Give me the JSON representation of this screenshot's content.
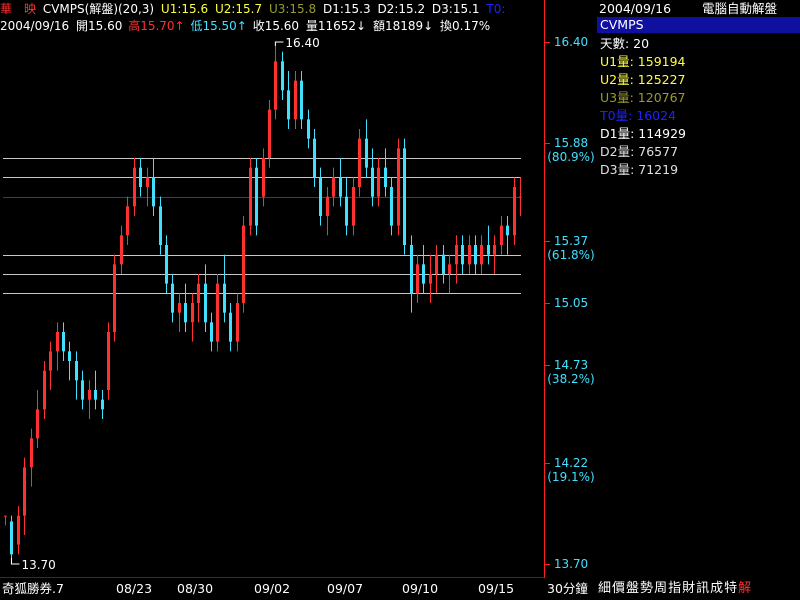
{
  "header": {
    "stock_name": "華　映",
    "indicator": "CVMPS(解盤)(20,3)",
    "u1": "U1:15.6",
    "u2": "U2:15.7",
    "u3": "U3:15.8",
    "d1": "D1:15.3",
    "d2": "D2:15.2",
    "d3": "D3:15.1",
    "t0": "T0:",
    "date": "2004/09/16",
    "open": "開15.60",
    "high": "高15.70↑",
    "low": "低15.50↑",
    "close": "收15.60",
    "volume": "量11652↓",
    "amount": "額18189↓",
    "turnover": "換0.17%"
  },
  "right_panel": {
    "date": "2004/09/16",
    "title": "電腦自動解盤",
    "indicator": "CVMPS",
    "days": "天數: 20",
    "u1": "U1量: 159194",
    "u2": "U2量: 125227",
    "u3": "U3量: 120767",
    "t0": "T0量: 16024",
    "d1": "D1量: 114929",
    "d2": "D2量: 76577",
    "d3": "D3量: 71219"
  },
  "bottom_bar": {
    "source": "奇狐勝券.7",
    "dates": [
      "08/23",
      "08/30",
      "09/02",
      "09/07",
      "09/10",
      "09/15"
    ],
    "period": "30分鐘",
    "menu": [
      "細",
      "價",
      "盤",
      "勢",
      "周",
      "指",
      "財",
      "訊",
      "成",
      "特",
      "解"
    ]
  },
  "colors": {
    "up": "#ff3030",
    "down": "#40e0ff",
    "axis": "#ff2020",
    "axis_text": "#40e0ff",
    "u1": "#ffff40",
    "u2": "#ffff40",
    "u3": "#9a9a30",
    "t0": "#2020ff",
    "hline": "#c8c8c8",
    "blue_line": "#2828ff",
    "highlight_bg": "#1010a0"
  },
  "chart_data": {
    "type": "candlestick",
    "ylim": [
      13.7,
      16.4
    ],
    "y_ticks": [
      {
        "value": 16.4,
        "label": "16.40",
        "pct": ""
      },
      {
        "value": 15.88,
        "label": "15.88",
        "pct": "(80.9%)"
      },
      {
        "value": 15.37,
        "label": "15.37",
        "pct": "(61.8%)"
      },
      {
        "value": 15.05,
        "label": "15.05",
        "pct": ""
      },
      {
        "value": 14.73,
        "label": "14.73",
        "pct": "(38.2%)"
      },
      {
        "value": 14.22,
        "label": "14.22",
        "pct": "(19.1%)"
      },
      {
        "value": 13.7,
        "label": "13.70",
        "pct": ""
      }
    ],
    "high_label": "16.40",
    "low_label": "13.70",
    "levels": [
      {
        "name": "U3",
        "value": 15.8
      },
      {
        "name": "U2",
        "value": 15.7
      },
      {
        "name": "U1",
        "value": 15.6
      },
      {
        "name": "D1",
        "value": 15.3
      },
      {
        "name": "D2",
        "value": 15.2
      },
      {
        "name": "D3",
        "value": 15.1
      }
    ],
    "candles": [
      [
        13.95,
        13.95,
        13.9,
        13.95
      ],
      [
        13.92,
        13.95,
        13.7,
        13.75
      ],
      [
        13.8,
        14.0,
        13.75,
        13.95
      ],
      [
        13.95,
        14.25,
        13.85,
        14.2
      ],
      [
        14.2,
        14.4,
        14.1,
        14.35
      ],
      [
        14.35,
        14.6,
        14.3,
        14.5
      ],
      [
        14.5,
        14.75,
        14.45,
        14.7
      ],
      [
        14.7,
        14.85,
        14.6,
        14.8
      ],
      [
        14.8,
        14.95,
        14.7,
        14.9
      ],
      [
        14.9,
        14.95,
        14.75,
        14.8
      ],
      [
        14.8,
        14.85,
        14.65,
        14.75
      ],
      [
        14.75,
        14.8,
        14.55,
        14.65
      ],
      [
        14.65,
        14.7,
        14.5,
        14.55
      ],
      [
        14.55,
        14.65,
        14.45,
        14.6
      ],
      [
        14.6,
        14.7,
        14.5,
        14.55
      ],
      [
        14.55,
        14.6,
        14.45,
        14.5
      ],
      [
        14.6,
        14.95,
        14.55,
        14.9
      ],
      [
        14.9,
        15.3,
        14.85,
        15.25
      ],
      [
        15.25,
        15.45,
        15.2,
        15.4
      ],
      [
        15.4,
        15.6,
        15.35,
        15.55
      ],
      [
        15.55,
        15.8,
        15.5,
        15.75
      ],
      [
        15.75,
        15.8,
        15.6,
        15.65
      ],
      [
        15.65,
        15.75,
        15.55,
        15.7
      ],
      [
        15.7,
        15.8,
        15.5,
        15.55
      ],
      [
        15.55,
        15.6,
        15.3,
        15.35
      ],
      [
        15.35,
        15.4,
        15.1,
        15.15
      ],
      [
        15.15,
        15.2,
        14.95,
        15.0
      ],
      [
        15.0,
        15.1,
        14.9,
        15.05
      ],
      [
        15.05,
        15.15,
        14.9,
        14.95
      ],
      [
        14.95,
        15.1,
        14.85,
        15.05
      ],
      [
        15.05,
        15.2,
        14.95,
        15.15
      ],
      [
        15.15,
        15.25,
        14.9,
        14.95
      ],
      [
        14.95,
        15.0,
        14.8,
        14.85
      ],
      [
        14.85,
        15.2,
        14.8,
        15.15
      ],
      [
        15.15,
        15.3,
        14.95,
        15.0
      ],
      [
        15.0,
        15.05,
        14.8,
        14.85
      ],
      [
        14.85,
        15.1,
        14.8,
        15.05
      ],
      [
        15.05,
        15.5,
        15.0,
        15.45
      ],
      [
        15.45,
        15.8,
        15.4,
        15.75
      ],
      [
        15.75,
        15.8,
        15.4,
        15.45
      ],
      [
        15.6,
        15.85,
        15.55,
        15.8
      ],
      [
        15.8,
        16.1,
        15.75,
        16.05
      ],
      [
        16.05,
        16.4,
        16.0,
        16.3
      ],
      [
        16.3,
        16.35,
        16.1,
        16.15
      ],
      [
        16.15,
        16.25,
        15.95,
        16.0
      ],
      [
        16.0,
        16.25,
        15.95,
        16.2
      ],
      [
        16.2,
        16.25,
        15.95,
        16.0
      ],
      [
        16.0,
        16.05,
        15.85,
        15.9
      ],
      [
        15.9,
        15.95,
        15.65,
        15.7
      ],
      [
        15.7,
        15.75,
        15.45,
        15.5
      ],
      [
        15.5,
        15.65,
        15.4,
        15.6
      ],
      [
        15.6,
        15.75,
        15.55,
        15.7
      ],
      [
        15.7,
        15.8,
        15.55,
        15.6
      ],
      [
        15.6,
        15.7,
        15.4,
        15.45
      ],
      [
        15.45,
        15.7,
        15.4,
        15.65
      ],
      [
        15.65,
        15.95,
        15.6,
        15.9
      ],
      [
        15.9,
        16.0,
        15.7,
        15.75
      ],
      [
        15.75,
        15.85,
        15.55,
        15.6
      ],
      [
        15.6,
        15.8,
        15.55,
        15.75
      ],
      [
        15.75,
        15.85,
        15.6,
        15.65
      ],
      [
        15.65,
        15.7,
        15.4,
        15.45
      ],
      [
        15.45,
        15.9,
        15.4,
        15.85
      ],
      [
        15.85,
        15.9,
        15.3,
        15.35
      ],
      [
        15.35,
        15.4,
        15.0,
        15.1
      ],
      [
        15.1,
        15.3,
        15.05,
        15.25
      ],
      [
        15.25,
        15.35,
        15.1,
        15.15
      ],
      [
        15.15,
        15.3,
        15.05,
        15.2
      ],
      [
        15.2,
        15.35,
        15.1,
        15.3
      ],
      [
        15.3,
        15.35,
        15.15,
        15.2
      ],
      [
        15.2,
        15.3,
        15.1,
        15.25
      ],
      [
        15.25,
        15.4,
        15.15,
        15.35
      ],
      [
        15.35,
        15.4,
        15.2,
        15.25
      ],
      [
        15.25,
        15.4,
        15.2,
        15.35
      ],
      [
        15.35,
        15.4,
        15.2,
        15.25
      ],
      [
        15.25,
        15.4,
        15.2,
        15.35
      ],
      [
        15.35,
        15.45,
        15.25,
        15.3
      ],
      [
        15.3,
        15.4,
        15.2,
        15.35
      ],
      [
        15.35,
        15.5,
        15.3,
        15.45
      ],
      [
        15.45,
        15.5,
        15.3,
        15.4
      ],
      [
        15.4,
        15.7,
        15.35,
        15.65
      ],
      [
        15.6,
        15.7,
        15.5,
        15.6
      ]
    ]
  }
}
